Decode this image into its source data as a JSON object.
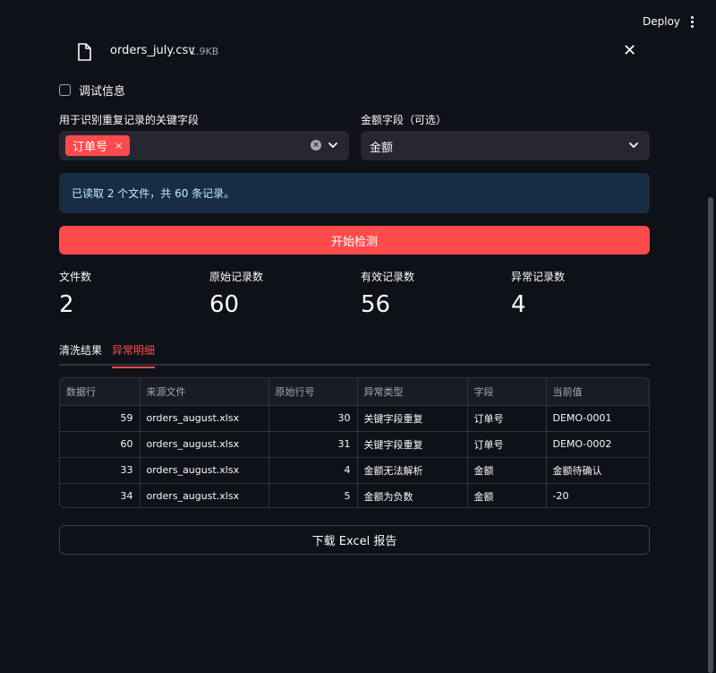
{
  "topbar": {
    "deploy_label": "Deploy",
    "menu_icon": "kebab-menu-icon"
  },
  "file": {
    "name": "orders_july.csv",
    "size": "1.9KB",
    "icon": "file-icon",
    "close_label": "✕"
  },
  "debug": {
    "label": "调试信息",
    "checked": false
  },
  "key_field": {
    "label": "用于识别重复记录的关键字段",
    "tags": [
      "订单号"
    ],
    "tag_remove": "×"
  },
  "amount_field": {
    "label": "金额字段（可选）",
    "value": "金额"
  },
  "info": {
    "text": "已读取 2 个文件，共 60 条记录。"
  },
  "start_button": {
    "label": "开始检测"
  },
  "metrics": [
    {
      "label": "文件数",
      "value": "2"
    },
    {
      "label": "原始记录数",
      "value": "60"
    },
    {
      "label": "有效记录数",
      "value": "56"
    },
    {
      "label": "异常记录数",
      "value": "4"
    }
  ],
  "tabs": [
    {
      "label": "清洗结果",
      "active": false
    },
    {
      "label": "异常明细",
      "active": true
    }
  ],
  "table": {
    "columns": [
      "数据行",
      "来源文件",
      "原始行号",
      "异常类型",
      "字段",
      "当前值"
    ],
    "rows": [
      [
        "59",
        "orders_august.xlsx",
        "30",
        "关键字段重复",
        "订单号",
        "DEMO-0001"
      ],
      [
        "60",
        "orders_august.xlsx",
        "31",
        "关键字段重复",
        "订单号",
        "DEMO-0002"
      ],
      [
        "33",
        "orders_august.xlsx",
        "4",
        "金额无法解析",
        "金额",
        "金额待确认"
      ],
      [
        "34",
        "orders_august.xlsx",
        "5",
        "金额为负数",
        "金额",
        "-20"
      ]
    ]
  },
  "download_button": {
    "label": "下载 Excel 报告"
  },
  "colors": {
    "primary": "#ff4b4b",
    "background": "#0e1117",
    "info_bg": "#172d43"
  }
}
